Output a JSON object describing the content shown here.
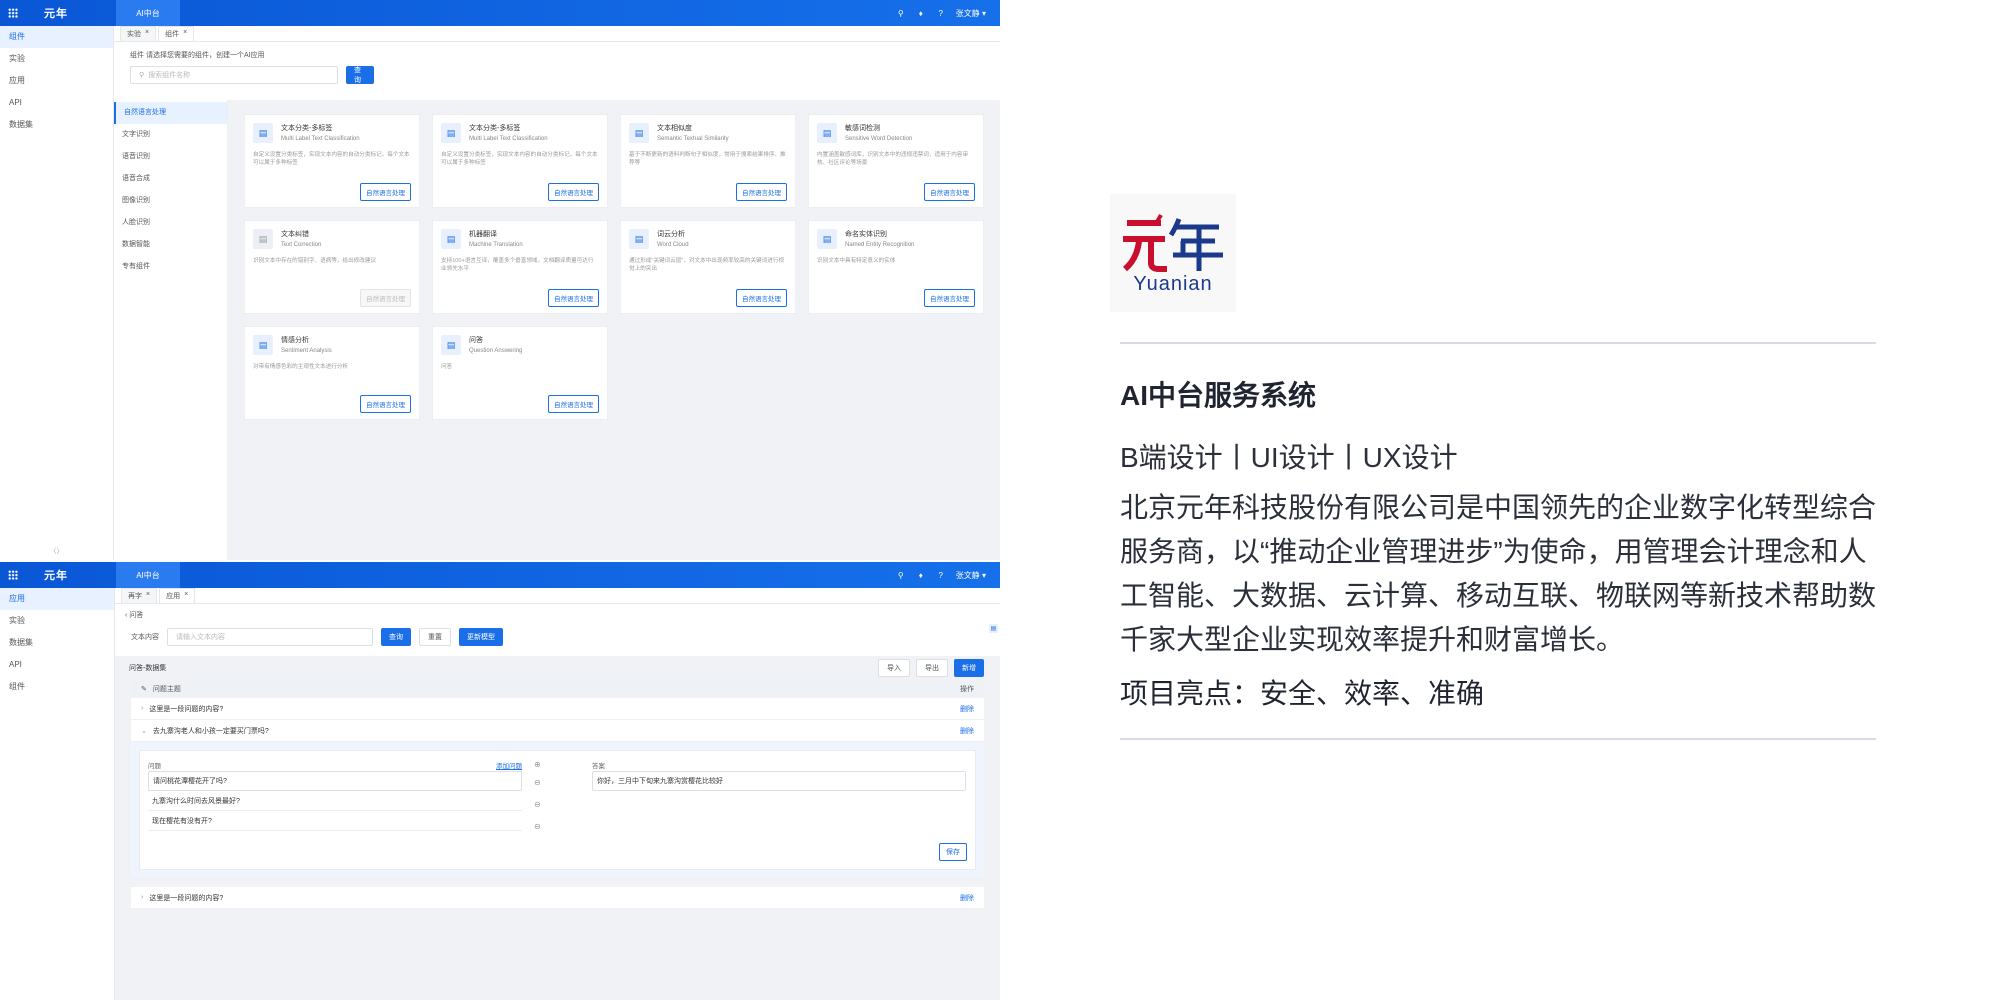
{
  "shot1": {
    "topbar": {
      "logo": "元年",
      "app_tab": "AI中台",
      "user": "张文静 ▾"
    },
    "nav": [
      "组件",
      "实验",
      "应用",
      "API",
      "数据集"
    ],
    "tabs": [
      {
        "label": "实验"
      },
      {
        "label": "组件"
      }
    ],
    "hint": "组件 请选择您需要的组件，创建一个AI应用",
    "search": {
      "placeholder": "搜索组件名称",
      "button": "查询"
    },
    "categories": [
      "自然语言处理",
      "文字识别",
      "语音识别",
      "语音合成",
      "图像识别",
      "人脸识别",
      "数据智能",
      "专有组件"
    ],
    "cards": [
      {
        "title": "文本分类-多标签",
        "sub": "Multi Label Text Classification",
        "desc": "自定义设置分类标签，实现文本内容的自动分类标记，每个文本可以属于多种标签",
        "btn": "自然语言处理",
        "disabled": false
      },
      {
        "title": "文本分类-多标签",
        "sub": "Multi Label Text Classification",
        "desc": "自定义设置分类标签，实现文本内容的自动分类标记，每个文本可以属于多种标签",
        "btn": "自然语言处理",
        "disabled": false
      },
      {
        "title": "文本相似度",
        "sub": "Semantic Textual Similarity",
        "desc": "基于不断更新的语料判断句子相似度，常用于搜索结果排序、推荐等",
        "btn": "自然语言处理",
        "disabled": false
      },
      {
        "title": "敏感词检测",
        "sub": "Sensitive Word Detection",
        "desc": "内置涵盖敏感词库，识别文本中的违规违禁词，适用于内容审核、社区评论等场景",
        "btn": "自然语言处理",
        "disabled": false
      },
      {
        "title": "文本纠错",
        "sub": "Text Correction",
        "desc": "识别文本中存在的错别字、语病等，给出修改建议",
        "btn": "自然语言处理",
        "disabled": true
      },
      {
        "title": "机器翻译",
        "sub": "Machine Translation",
        "desc": "支持100+语言互译，覆盖多个垂直领域，文档翻译质量可达行业领先水平",
        "btn": "自然语言处理",
        "disabled": false
      },
      {
        "title": "词云分析",
        "sub": "Word Cloud",
        "desc": "通过形成\"关键词云层\"，对文本中出现频率较高的关键词进行视觉上的突出",
        "btn": "自然语言处理",
        "disabled": false
      },
      {
        "title": "命名实体识别",
        "sub": "Named Entity Recognition",
        "desc": "识别文本中具有特定意义的实体",
        "btn": "自然语言处理",
        "disabled": false
      },
      {
        "title": "情感分析",
        "sub": "Sentiment Analysis",
        "desc": "对带有情感色彩的主观性文本进行分析",
        "btn": "自然语言处理",
        "disabled": false
      },
      {
        "title": "问答",
        "sub": "Question Answering",
        "desc": "问答",
        "btn": "自然语言处理",
        "disabled": false
      }
    ]
  },
  "shot2": {
    "topbar": {
      "logo": "元年",
      "app_tab": "AI中台",
      "user": "张文静 ▾"
    },
    "nav": [
      "应用",
      "实验",
      "数据集",
      "API",
      "组件"
    ],
    "tabs": [
      {
        "label": "再字"
      },
      {
        "label": "应用"
      }
    ],
    "back": "‹ 问答",
    "filter": {
      "label": "文本内容",
      "placeholder": "请输入文本内容",
      "query": "查询",
      "reset": "重置",
      "update": "更新模型"
    },
    "dataset": {
      "title": "问答-数据集",
      "import": "导入",
      "export": "导出",
      "add": "新增"
    },
    "table": {
      "header": "问题主题",
      "op_header": "操作",
      "rows": [
        {
          "text": "这里是一段问题的内容?",
          "op": "删除"
        },
        {
          "text": "去九寨沟老人和小孩一定要买门票吗?",
          "op": "删除"
        }
      ],
      "last_row": {
        "text": "这里是一段问题的内容?",
        "op": "删除"
      }
    },
    "expand": {
      "q_label": "问题",
      "add_q": "添加问题",
      "a_label": "答案",
      "questions": [
        "请问桃花潭樱花开了吗?",
        "九寨沟什么时间去风景最好?",
        "现在樱花有没有开?"
      ],
      "answer": "你好，三月中下旬来九寨沟赏樱花比较好",
      "save": "保存"
    }
  },
  "panel": {
    "logo_cn": "元年",
    "logo_en": "Yuanian",
    "title": "AI中台服务系统",
    "subtitle": "B端设计丨UI设计丨UX设计",
    "description": "北京元年科技股份有限公司是中国领先的企业数字化转型综合服务商，以“推动企业管理进步”为使命，用管理会计理念和人工智能、大数据、云计算、移动互联、物联网等新技术帮助数千家大型企业实现效率提升和财富增长。",
    "highlights": "项目亮点：安全、效率、准确"
  },
  "colors": {
    "primary": "#1a6ee8",
    "brand_red": "#c8102e",
    "brand_navy": "#1b3a8c"
  }
}
